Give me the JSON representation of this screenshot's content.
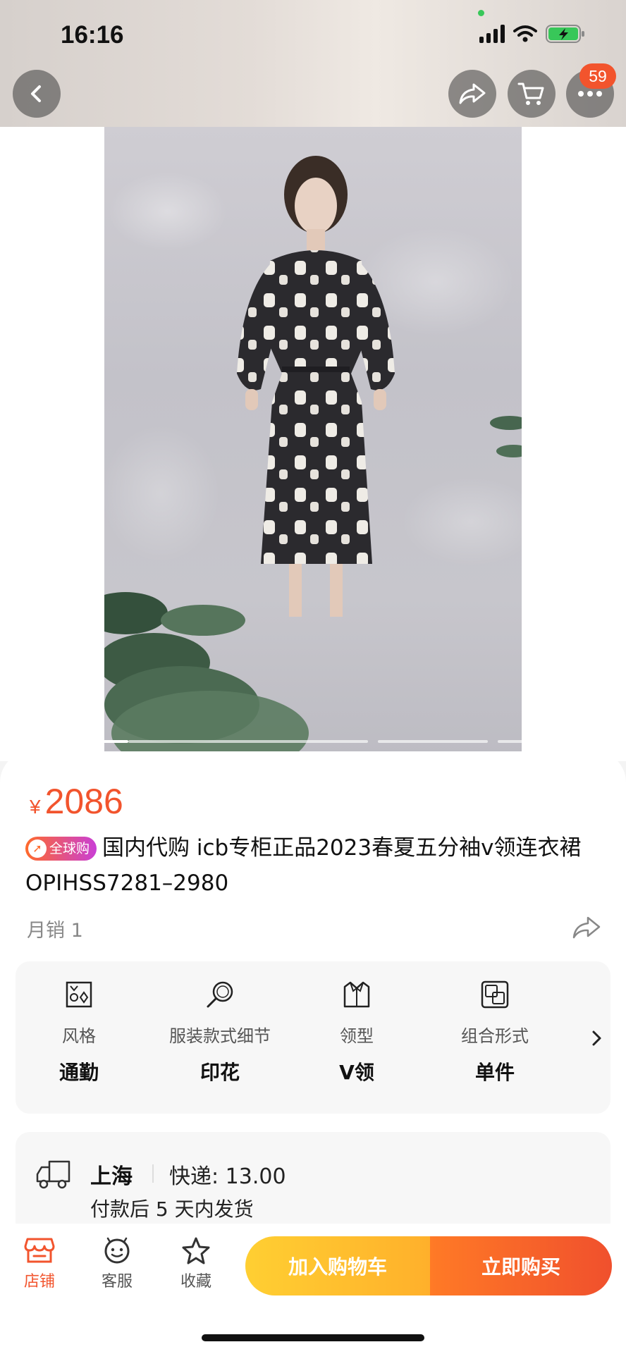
{
  "status_bar": {
    "time": "16:16"
  },
  "nav": {
    "cart_badge": "59"
  },
  "gallery": {
    "total_slides": 4,
    "active_slide": 1
  },
  "product": {
    "currency": "¥",
    "price": "2086",
    "tag": "全球购",
    "title": "国内代购 icb专柜正品2023春夏五分袖v领连衣裙OPIHSS7281–2980",
    "sales": "月销 1"
  },
  "attributes": [
    {
      "label": "风格",
      "value": "通勤",
      "icon": "style-icon"
    },
    {
      "label": "服装款式细节",
      "value": "印花",
      "icon": "magnifier-icon"
    },
    {
      "label": "领型",
      "value": "V领",
      "icon": "collar-icon"
    },
    {
      "label": "组合形式",
      "value": "单件",
      "icon": "combination-icon"
    }
  ],
  "shipping": {
    "city": "上海",
    "fee": "快递: 13.00",
    "time": "付款后 5 天内发货"
  },
  "bottom_bar": {
    "shop": "店铺",
    "service": "客服",
    "favorite": "收藏",
    "add_to_cart": "加入购物车",
    "buy_now": "立即购买"
  },
  "colors": {
    "accent": "#f2542d",
    "cart_button": "#ffb02b",
    "buy_button": "#f0502d"
  }
}
